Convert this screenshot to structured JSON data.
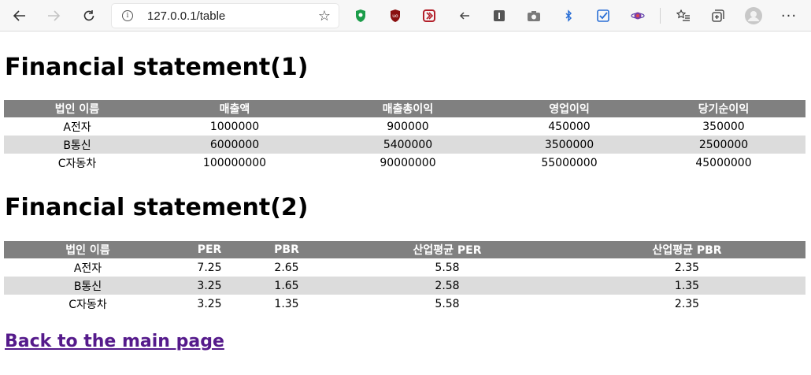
{
  "browser": {
    "url": "127.0.0.1/table",
    "menu_glyph": "···"
  },
  "section1": {
    "title": "Financial statement(1)",
    "headers": [
      "법인 이름",
      "매출액",
      "매출총이익",
      "영업이익",
      "당기순이익"
    ],
    "rows": [
      [
        "A전자",
        "1000000",
        "900000",
        "450000",
        "350000"
      ],
      [
        "B통신",
        "6000000",
        "5400000",
        "3500000",
        "2500000"
      ],
      [
        "C자동차",
        "100000000",
        "90000000",
        "55000000",
        "45000000"
      ]
    ]
  },
  "section2": {
    "title": "Financial statement(2)",
    "headers": [
      "법인 이름",
      "PER",
      "PBR",
      "산업평균 PER",
      "산업평균 PBR"
    ],
    "rows": [
      [
        "A전자",
        "7.25",
        "2.65",
        "5.58",
        "2.35"
      ],
      [
        "B통신",
        "3.25",
        "1.65",
        "2.58",
        "1.35"
      ],
      [
        "C자동차",
        "3.25",
        "1.35",
        "5.58",
        "2.35"
      ]
    ]
  },
  "footer": {
    "back_link": "Back to the main page"
  },
  "colors": {
    "header_bg": "#808080",
    "stripe_bg": "#dcdcdc",
    "link_visited": "#551a8b"
  }
}
